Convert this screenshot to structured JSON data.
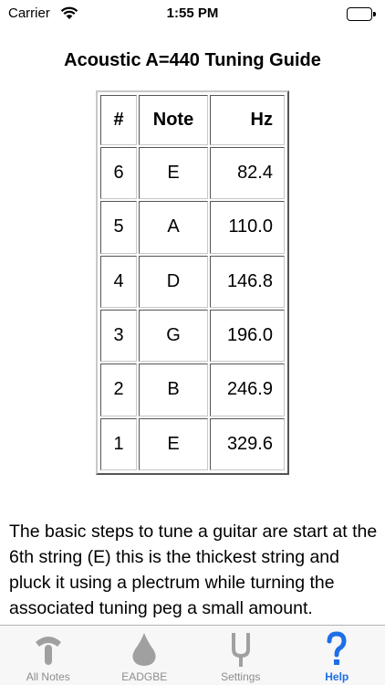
{
  "status_bar": {
    "carrier": "Carrier",
    "time": "1:55 PM",
    "battery_level": 1.0
  },
  "title": "Acoustic A=440 Tuning Guide",
  "table": {
    "headers": {
      "num": "#",
      "note": "Note",
      "hz": "Hz"
    },
    "rows": [
      {
        "num": "6",
        "note": "E",
        "hz": "82.4"
      },
      {
        "num": "5",
        "note": "A",
        "hz": "110.0"
      },
      {
        "num": "4",
        "note": "D",
        "hz": "146.8"
      },
      {
        "num": "3",
        "note": "G",
        "hz": "196.0"
      },
      {
        "num": "2",
        "note": "B",
        "hz": "246.9"
      },
      {
        "num": "1",
        "note": "E",
        "hz": "329.6"
      }
    ]
  },
  "body_text": "The basic steps to tune a guitar are start at the 6th string (E) this is the thickest string and pluck it using a plectrum while turning the associated tuning peg a small amount.",
  "tab_bar": {
    "tabs": [
      {
        "label": "All Notes",
        "icon": "tuning-peg-icon",
        "active": false
      },
      {
        "label": "EADGBE",
        "icon": "pick-icon",
        "active": false
      },
      {
        "label": "Settings",
        "icon": "tuning-fork-icon",
        "active": false
      },
      {
        "label": "Help",
        "icon": "question-icon",
        "active": true
      }
    ],
    "active_color": "#1e6ee6",
    "inactive_color": "#8e8e8e"
  }
}
